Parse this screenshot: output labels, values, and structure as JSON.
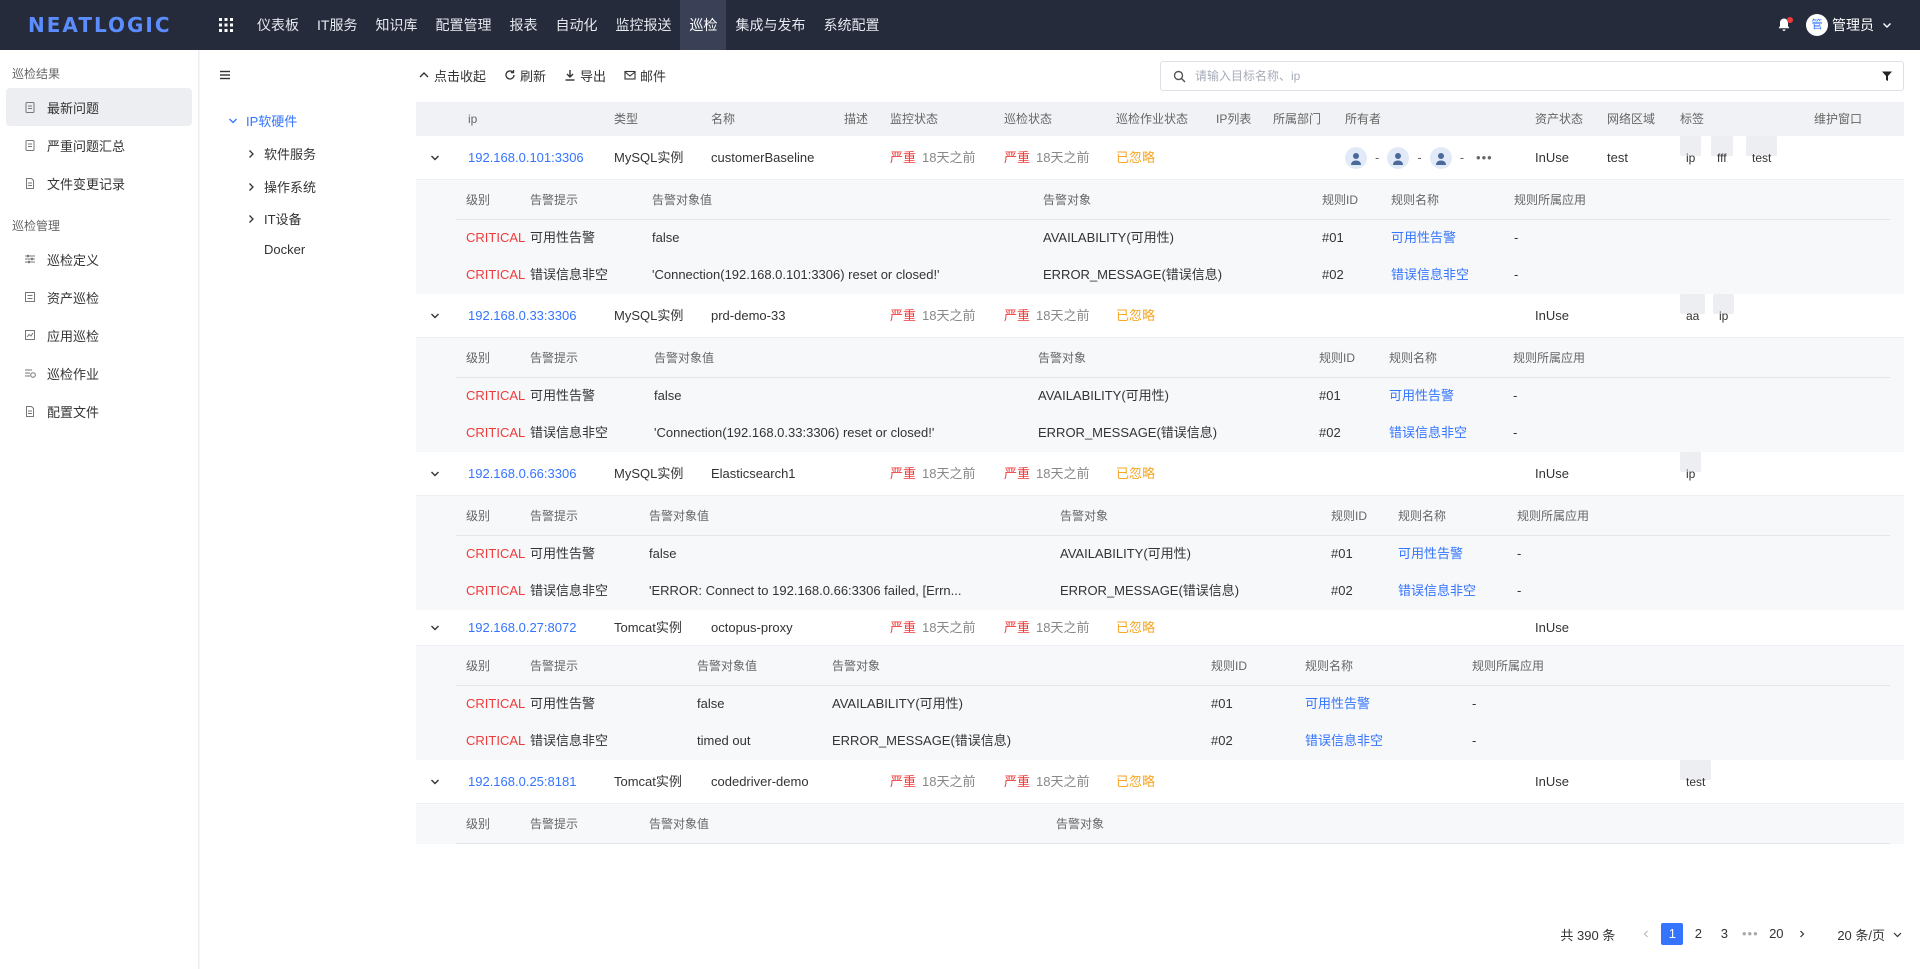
{
  "brand": {
    "logo": "NEATLOGIC"
  },
  "topnav": {
    "menu": [
      "仪表板",
      "IT服务",
      "知识库",
      "配置管理",
      "报表",
      "自动化",
      "监控报送",
      "巡检",
      "集成与发布",
      "系统配置"
    ],
    "active": "巡检",
    "user_avatar": "管",
    "user_name": "管理员"
  },
  "sidebar": {
    "group1": "巡检结果",
    "items1": [
      "最新问题",
      "严重问题汇总",
      "文件变更记录"
    ],
    "group2": "巡检管理",
    "items2": [
      "巡检定义",
      "资产巡检",
      "应用巡检",
      "巡检作业",
      "配置文件"
    ]
  },
  "tree": {
    "root": "IP软硬件",
    "children": [
      "软件服务",
      "操作系统",
      "IT设备",
      "Docker"
    ]
  },
  "toolbar": {
    "collapse": "点击收起",
    "refresh": "刷新",
    "export": "导出",
    "mail": "邮件",
    "search_placeholder": "请输入目标名称、ip"
  },
  "table": {
    "headers": [
      "ip",
      "类型",
      "名称",
      "描述",
      "监控状态",
      "巡检状态",
      "巡检作业状态",
      "IP列表",
      "所属部门",
      "所有者",
      "资产状态",
      "网络区域",
      "标签",
      "维护窗口"
    ],
    "sub_headers": [
      "级别",
      "告警提示",
      "告警对象值",
      "告警对象",
      "规则ID",
      "规则名称",
      "规则所属应用"
    ],
    "rows": [
      {
        "ip": "192.168.0.101:3306",
        "type": "MySQL实例",
        "name": "customerBaseline",
        "monitor_sev": "严重",
        "monitor_ago": "18天之前",
        "inspect_sev": "严重",
        "inspect_ago": "18天之前",
        "job_status": "已忽略",
        "owners": [
          "-",
          "-",
          "-"
        ],
        "asset_status": "InUse",
        "zone": "test",
        "tags": [
          "ip",
          "fff",
          "test"
        ],
        "alerts": [
          {
            "level": "CRITICAL",
            "hint": "可用性告警",
            "value": "false",
            "target": "AVAILABILITY(可用性)",
            "rule_id": "#01",
            "rule_name": "可用性告警",
            "app": "-"
          },
          {
            "level": "CRITICAL",
            "hint": "错误信息非空",
            "value": "'Connection(192.168.0.101:3306) reset or closed!'",
            "target": "ERROR_MESSAGE(错误信息)",
            "rule_id": "#02",
            "rule_name": "错误信息非空",
            "app": "-"
          }
        ]
      },
      {
        "ip": "192.168.0.33:3306",
        "type": "MySQL实例",
        "name": "prd-demo-33",
        "monitor_sev": "严重",
        "monitor_ago": "18天之前",
        "inspect_sev": "严重",
        "inspect_ago": "18天之前",
        "job_status": "已忽略",
        "asset_status": "InUse",
        "zone": "",
        "tags": [
          "aa",
          "ip"
        ],
        "alerts": [
          {
            "level": "CRITICAL",
            "hint": "可用性告警",
            "value": "false",
            "target": "AVAILABILITY(可用性)",
            "rule_id": "#01",
            "rule_name": "可用性告警",
            "app": "-"
          },
          {
            "level": "CRITICAL",
            "hint": "错误信息非空",
            "value": "'Connection(192.168.0.33:3306) reset or closed!'",
            "target": "ERROR_MESSAGE(错误信息)",
            "rule_id": "#02",
            "rule_name": "错误信息非空",
            "app": "-"
          }
        ]
      },
      {
        "ip": "192.168.0.66:3306",
        "type": "MySQL实例",
        "name": "Elasticsearch1",
        "monitor_sev": "严重",
        "monitor_ago": "18天之前",
        "inspect_sev": "严重",
        "inspect_ago": "18天之前",
        "job_status": "已忽略",
        "asset_status": "InUse",
        "zone": "",
        "tags": [
          "ip"
        ],
        "alerts": [
          {
            "level": "CRITICAL",
            "hint": "可用性告警",
            "value": "false",
            "target": "AVAILABILITY(可用性)",
            "rule_id": "#01",
            "rule_name": "可用性告警",
            "app": "-"
          },
          {
            "level": "CRITICAL",
            "hint": "错误信息非空",
            "value": "'ERROR: Connect to 192.168.0.66:3306 failed, [Errn...",
            "target": "ERROR_MESSAGE(错误信息)",
            "rule_id": "#02",
            "rule_name": "错误信息非空",
            "app": "-"
          }
        ]
      },
      {
        "ip": "192.168.0.27:8072",
        "type": "Tomcat实例",
        "name": "octopus-proxy",
        "monitor_sev": "严重",
        "monitor_ago": "18天之前",
        "inspect_sev": "严重",
        "inspect_ago": "18天之前",
        "job_status": "已忽略",
        "asset_status": "InUse",
        "zone": "",
        "tags": [],
        "alerts": [
          {
            "level": "CRITICAL",
            "hint": "可用性告警",
            "value": "false",
            "target": "AVAILABILITY(可用性)",
            "rule_id": "#01",
            "rule_name": "可用性告警",
            "app": "-"
          },
          {
            "level": "CRITICAL",
            "hint": "错误信息非空",
            "value": "timed out",
            "target": "ERROR_MESSAGE(错误信息)",
            "rule_id": "#02",
            "rule_name": "错误信息非空",
            "app": "-"
          }
        ]
      },
      {
        "ip": "192.168.0.25:8181",
        "type": "Tomcat实例",
        "name": "codedriver-demo",
        "monitor_sev": "严重",
        "monitor_ago": "18天之前",
        "inspect_sev": "严重",
        "inspect_ago": "18天之前",
        "job_status": "已忽略",
        "asset_status": "InUse",
        "zone": "",
        "tags": [
          "test"
        ],
        "alerts": []
      }
    ]
  },
  "pager": {
    "total": "共 390 条",
    "pages": [
      "1",
      "2",
      "3",
      "20"
    ],
    "current": "1",
    "page_size": "20 条/页"
  },
  "colors": {
    "accent": "#3474ff",
    "critical": "#f03a3a",
    "ignored": "#f5a623",
    "nav_bg": "#262b3b"
  }
}
